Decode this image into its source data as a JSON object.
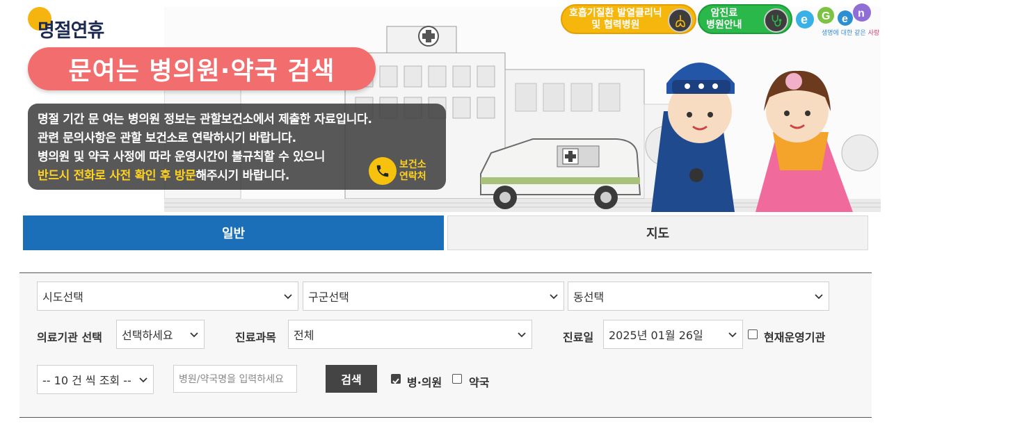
{
  "banner": {
    "logo_text": "명절연휴",
    "title": "문여는 병의원·약국 검색",
    "notice": {
      "line1": "명절 기간 문 여는 병의원 정보는 관할보건소에서 제출한 자료입니다.",
      "line2": "관련 문의사항은 관할 보건소로 연락하시기 바랍니다.",
      "line3": "병의원 및 약국 사정에 따라 운영시간이 불규칙할 수 있으니",
      "line4_highlight": "반드시 전화로 사전 확인 후 방문",
      "line4_rest": "해주시기 바랍니다."
    },
    "contact_label": "보건소 연락처",
    "respiratory_button": {
      "line1": "호흡기질환 발열클리닉",
      "line2": "및 협력병원"
    },
    "cancer_button": {
      "line1": "암진료",
      "line2": "병원안내"
    },
    "egen_logo": {
      "text": "e-Gen",
      "tagline_a": "생명에 대한 같은",
      "tagline_b": "사랑"
    },
    "colors": {
      "title_bg": "#f26d6d",
      "yellow": "#f6b70d",
      "green": "#2ab84a",
      "highlight": "#ffd21f"
    }
  },
  "tabs": [
    {
      "label": "일반",
      "active": true
    },
    {
      "label": "지도",
      "active": false
    }
  ],
  "filters": {
    "sido": "시도선택",
    "gugun": "구군선택",
    "dong": "동선택",
    "institution_label": "의료기관 선택",
    "institution_value": "선택하세요",
    "department_label": "진료과목",
    "department_value": "전체",
    "date_label": "진료일",
    "date_value": "2025년 01월 26일",
    "operating_now_label": "현재운영기관",
    "operating_now_checked": false,
    "page_size_value": "-- 10 건 씩 조회 --",
    "search_placeholder": "병원/약국명을 입력하세요",
    "search_button": "검색",
    "hospital_label": "병·의원",
    "hospital_checked": true,
    "pharmacy_label": "약국",
    "pharmacy_checked": false
  },
  "accent_color": "#1a6fb8"
}
